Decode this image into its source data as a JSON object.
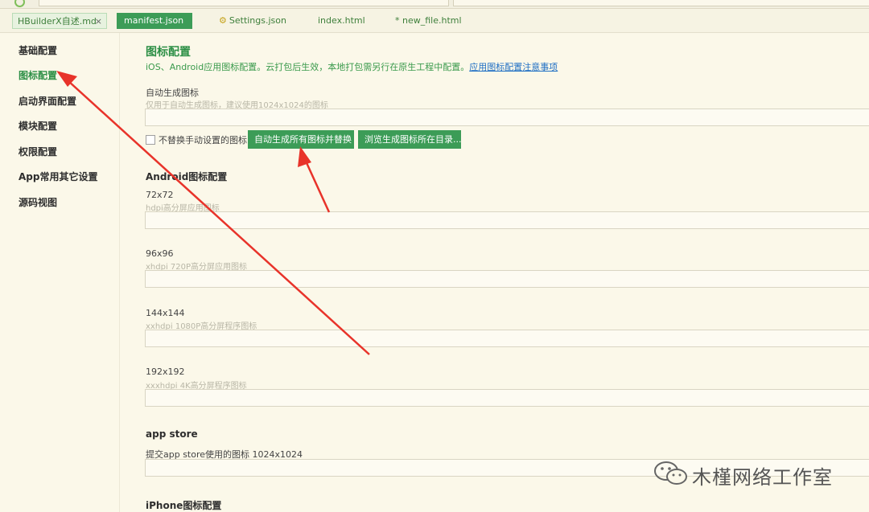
{
  "tabs": [
    {
      "label": "HBuilderX自述.md",
      "close": "×"
    },
    {
      "label": "manifest.json"
    },
    {
      "label": "Settings.json",
      "icon": "gear-icon"
    },
    {
      "label": "index.html"
    },
    {
      "label": "* new_file.html"
    }
  ],
  "sidebar": {
    "items": [
      {
        "label": "基础配置"
      },
      {
        "label": "图标配置",
        "active": true
      },
      {
        "label": "启动界面配置"
      },
      {
        "label": "模块配置"
      },
      {
        "label": "权限配置"
      },
      {
        "label": "App常用其它设置"
      },
      {
        "label": "源码视图"
      }
    ]
  },
  "main": {
    "title": "图标配置",
    "subtitle": "iOS、Android应用图标配置。云打包后生效，本地打包需另行在原生工程中配置。",
    "subtitle_link": "应用图标配置注意事项",
    "auto_gen": {
      "label": "自动生成图标",
      "hint": "仅用于自动生成图标，建议使用1024x1024的图标",
      "value": ""
    },
    "checkbox_label": "不替换手动设置的图标",
    "btn_generate": "自动生成所有图标并替换",
    "btn_browse": "浏览生成图标所在目录...",
    "android_section": "Android图标配置",
    "android": [
      {
        "size": "72x72",
        "hint": "hdpi高分屏应用图标",
        "value": ""
      },
      {
        "size": "96x96",
        "hint": "xhdpi 720P高分屏应用图标",
        "value": ""
      },
      {
        "size": "144x144",
        "hint": "xxhdpi 1080P高分屏程序图标",
        "value": ""
      },
      {
        "size": "192x192",
        "hint": "xxxhdpi 4K高分屏程序图标",
        "value": ""
      }
    ],
    "appstore_section": "app store",
    "appstore_label": "提交app store使用的图标 1024x1024",
    "appstore_value": "",
    "iphone_section": "iPhone图标配置"
  },
  "watermark": {
    "text": "木槿网络工作室",
    "icon": "wechat-icon"
  },
  "colors": {
    "accent": "#3c9c57",
    "annotation": "#e8332a",
    "background": "#fbf8e9"
  }
}
